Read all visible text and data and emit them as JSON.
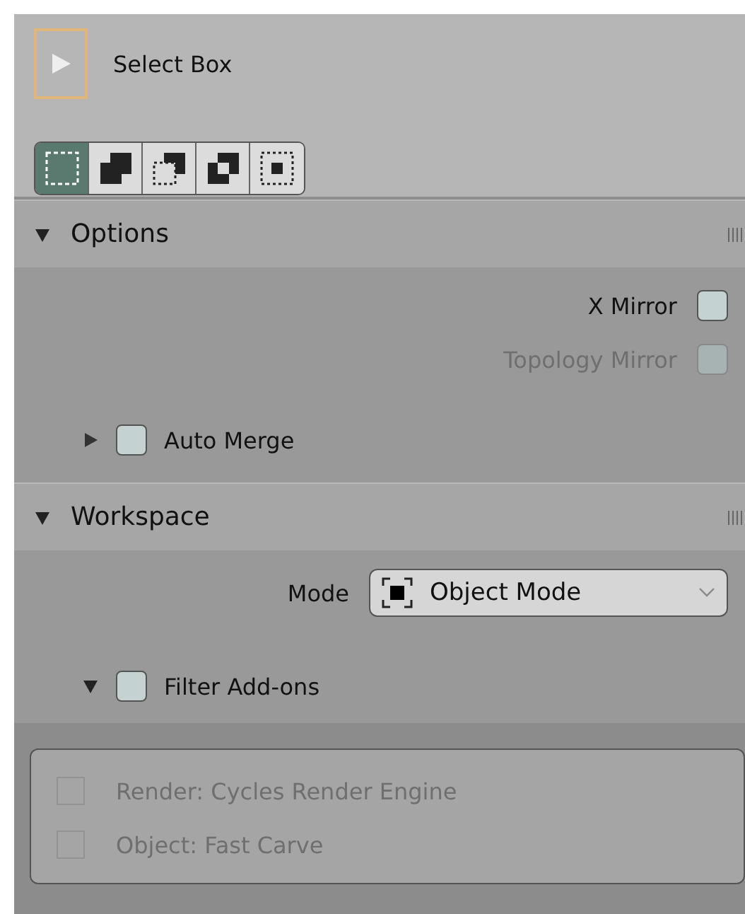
{
  "tool": {
    "name": "Select Box",
    "active": true
  },
  "select_modes": [
    {
      "kind": "new",
      "selected": true
    },
    {
      "kind": "extend",
      "selected": false
    },
    {
      "kind": "subtract",
      "selected": false
    },
    {
      "kind": "invert",
      "selected": false
    },
    {
      "kind": "intersect",
      "selected": false
    }
  ],
  "options": {
    "title": "Options",
    "expanded": true,
    "mirrors": [
      {
        "label": "X Mirror",
        "checked": false,
        "disabled": false
      },
      {
        "label": "Topology Mirror",
        "checked": false,
        "disabled": true
      }
    ],
    "auto_merge": {
      "label": "Auto Merge",
      "checked": false,
      "expanded": false
    }
  },
  "workspace": {
    "title": "Workspace",
    "expanded": true,
    "mode": {
      "label": "Mode",
      "value": "Object Mode"
    },
    "filter_addons": {
      "label": "Filter Add-ons",
      "checked": false,
      "expanded": true
    },
    "addons": [
      {
        "label": "Render: Cycles Render Engine",
        "checked": false,
        "disabled": true
      },
      {
        "label": "Object: Fast Carve",
        "checked": false,
        "disabled": true
      }
    ]
  }
}
